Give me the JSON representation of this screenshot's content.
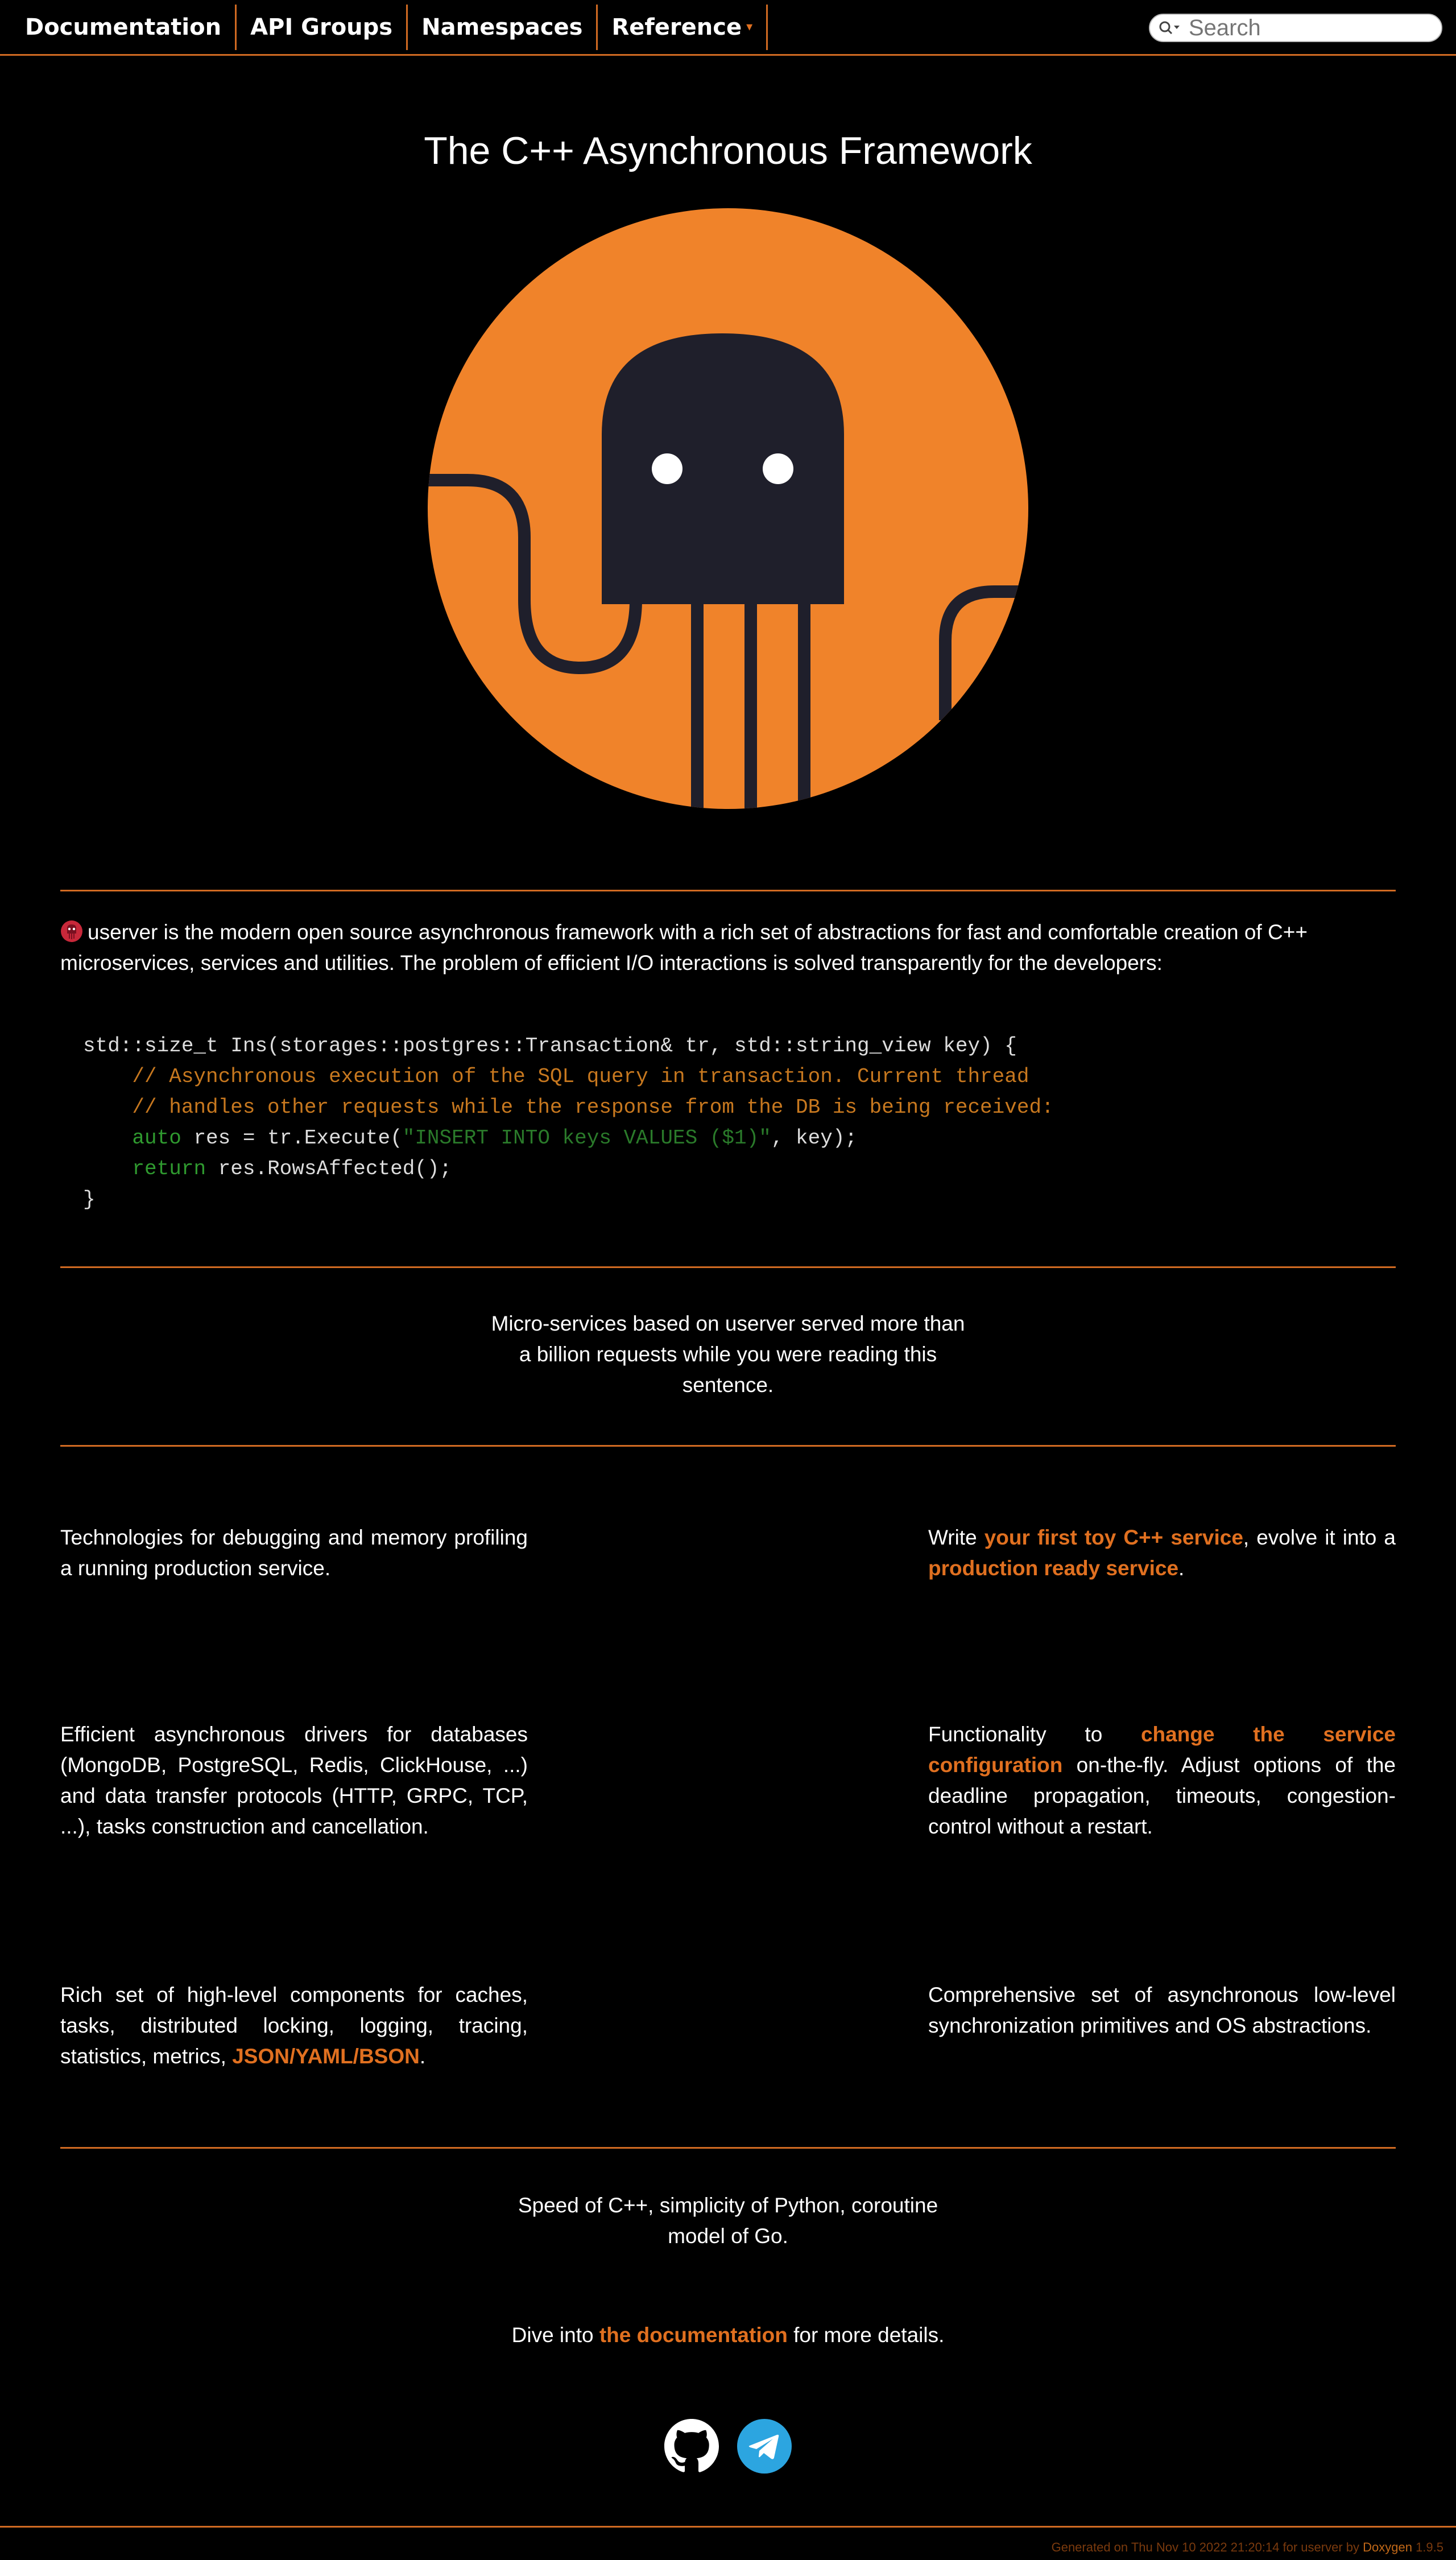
{
  "nav": {
    "items": [
      "Documentation",
      "API Groups",
      "Namespaces",
      "Reference"
    ],
    "search_placeholder": "Search"
  },
  "hero": {
    "title": "The C++ Asynchronous Framework"
  },
  "intro": {
    "text": "userver is the modern open source asynchronous framework with a rich set of abstractions for fast and comfortable creation of C++ microservices, services and utilities. The problem of efficient I/O interactions is solved transparently for the developers:"
  },
  "code": {
    "line1": "std::size_t Ins(storages::postgres::Transaction& tr, std::string_view key) {",
    "line2": "    // Asynchronous execution of the SQL query in transaction. Current thread",
    "line3": "    // handles other requests while the response from the DB is being received:",
    "line4_kw": "auto",
    "line4_a": " res = tr.Execute(",
    "line4_str": "\"INSERT INTO keys VALUES ($1)\"",
    "line4_b": ", key);",
    "line5_kw": "return",
    "line5_a": " res.RowsAffected();",
    "line6": "}"
  },
  "quote1": {
    "l1": "Micro-services based on userver served more than",
    "l2": "a billion requests while you were reading this",
    "l3": "sentence."
  },
  "features": {
    "f1": "Technologies for debugging and memory profiling a running production service.",
    "f2_pre": "Write ",
    "f2_link1": "your first toy C++ service",
    "f2_mid": ", evolve it into a ",
    "f2_link2": "production ready service",
    "f2_post": ".",
    "f3": "Efficient asynchronous drivers for databases (MongoDB, PostgreSQL, Redis, ClickHouse, ...) and data transfer protocols (HTTP, GRPC, TCP, ...), tasks construction and cancellation.",
    "f4_pre": "Functionality to ",
    "f4_link": "change the service configuration",
    "f4_post": " on-the-fly. Adjust options of the deadline propagation, timeouts, congestion-control without a restart.",
    "f5_pre": "Rich set of high-level components for caches, tasks, distributed locking, logging, tracing, statistics, metrics, ",
    "f5_link": "JSON/YAML/BSON",
    "f5_post": ".",
    "f6": "Comprehensive set of asynchronous low-level synchronization primitives and OS abstractions."
  },
  "quote2": {
    "l1": "Speed of C++, simplicity of Python, coroutine",
    "l2": "model of Go."
  },
  "dive": {
    "pre": "Dive into ",
    "link": "the documentation",
    "post": " for more details."
  },
  "social": {
    "icons": [
      "github-icon",
      "telegram-icon"
    ]
  },
  "footer": {
    "text": "Generated on Thu Nov 10 2022 21:20:14 for userver by ",
    "link": "Doxygen",
    "version": " 1.9.5"
  },
  "colors": {
    "accent": "#d06a22",
    "logo_orange": "#f0832a",
    "logo_dark": "#1f1f2b",
    "telegram": "#2ca5e0"
  }
}
